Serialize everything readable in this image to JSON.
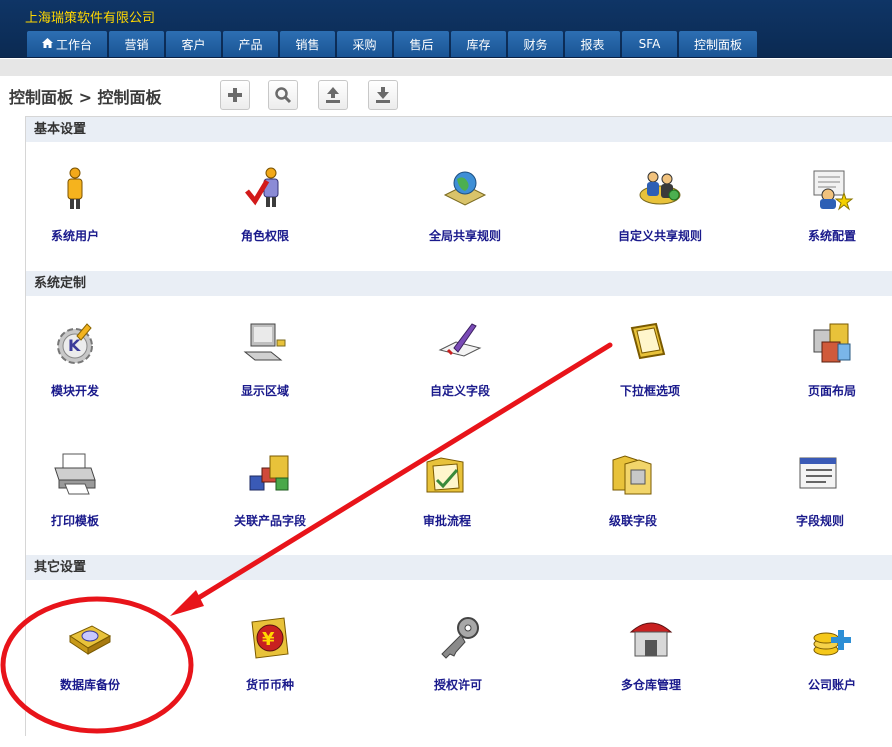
{
  "header": {
    "company": "上海瑞策软件有限公司",
    "nav": [
      "工作台",
      "营销",
      "客户",
      "产品",
      "销售",
      "采购",
      "售后",
      "库存",
      "财务",
      "报表",
      "SFA",
      "控制面板"
    ]
  },
  "breadcrumb": "控制面板 > 控制面板",
  "sections": {
    "basic": {
      "title": "基本设置",
      "items": [
        "系统用户",
        "角色权限",
        "全局共享规则",
        "自定义共享规则",
        "系统配置"
      ]
    },
    "custom": {
      "title": "系统定制",
      "items": [
        "模块开发",
        "显示区域",
        "自定义字段",
        "下拉框选项",
        "页面布局",
        "打印模板",
        "关联产品字段",
        "审批流程",
        "级联字段",
        "字段规则"
      ]
    },
    "other": {
      "title": "其它设置",
      "items": [
        "数据库备份",
        "货币币种",
        "授权许可",
        "多仓库管理",
        "公司账户"
      ]
    }
  },
  "colors": {
    "header": "#0f3566",
    "tab": "#2d6fb3",
    "company": "#ffd700",
    "link": "#1a1a8c",
    "annotation": "#e8141a"
  }
}
